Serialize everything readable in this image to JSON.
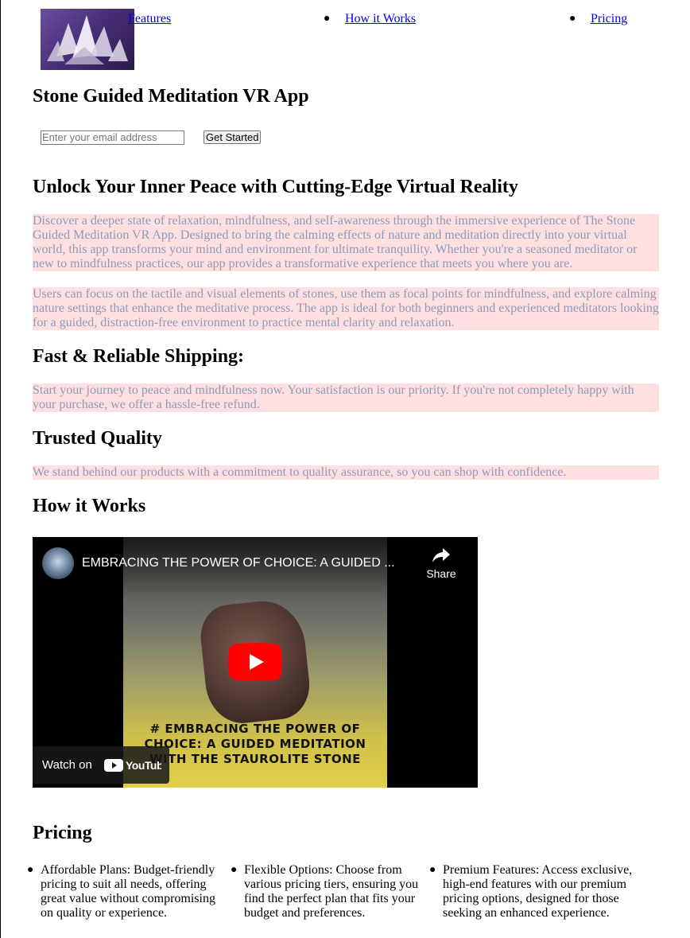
{
  "nav": {
    "logo_alt": "crystal cluster image",
    "links": [
      "Features",
      "How it Works",
      "Pricing"
    ]
  },
  "app_title": "Stone Guided Meditation VR App",
  "signup": {
    "email_placeholder": "Enter your email address",
    "button_label": "Get Started"
  },
  "sections": {
    "intro_heading": "Unlock Your Inner Peace with Cutting-Edge Virtual Reality",
    "intro_paragraphs": [
      "Discover a deeper state of relaxation, mindfulness, and self-awareness through the immersive experience of The Stone Guided Meditation VR App. Designed to bring the calming effects of nature and meditation directly into your virtual world, this app transforms your mind and environment for ultimate tranquility. Whether you're a seasoned meditator or new to mindfulness practices, our app provides a transformative experience that meets you where you are.",
      "Users can focus on the tactile and visual elements of stones, use them as focal points for mindfulness, and explore calming nature settings that enhance the meditative process. The app is ideal for both beginners and experienced meditators looking for a guided, distraction-free environment to practice mental clarity and relaxation."
    ],
    "shipping_heading": "Fast & Reliable Shipping:",
    "shipping_text": "Start your journey to peace and mindfulness now. Your satisfaction is our priority. If you're not completely happy with your purchase, we offer a hassle-free refund.",
    "quality_heading": "Trusted Quality",
    "quality_text": "We stand behind our products with a commitment to quality assurance, so you can shop with confidence.",
    "how_heading": "How it Works",
    "pricing_heading": "Pricing"
  },
  "video": {
    "title": "EMBRACING THE POWER OF CHOICE: A GUIDED ...",
    "share_label": "Share",
    "caption_lines": [
      "# EMBRACING THE POWER OF",
      "CHOICE: A GUIDED MEDITATION",
      "WITH THE STAUROLITE STONE"
    ],
    "watch_on_label": "Watch on",
    "youtube_label": "YouTube",
    "icons": {
      "share": "share-arrow-icon",
      "play": "youtube-play-icon"
    }
  },
  "pricing": [
    "Affordable Plans: Budget-friendly pricing to suit all needs, offering great value without compromising on quality or experience.",
    "Flexible Options: Choose from various pricing tiers, ensuring you find the perfect plan that fits your budget and preferences.",
    "Premium Features: Access exclusive, high-end features with our premium pricing options, designed for those seeking an enhanced experience."
  ],
  "colors": {
    "link": "#0000ee",
    "pink_bg": "#ffe0e0",
    "muted_text": "#8c9bb8",
    "play_red": "#ff0000"
  }
}
